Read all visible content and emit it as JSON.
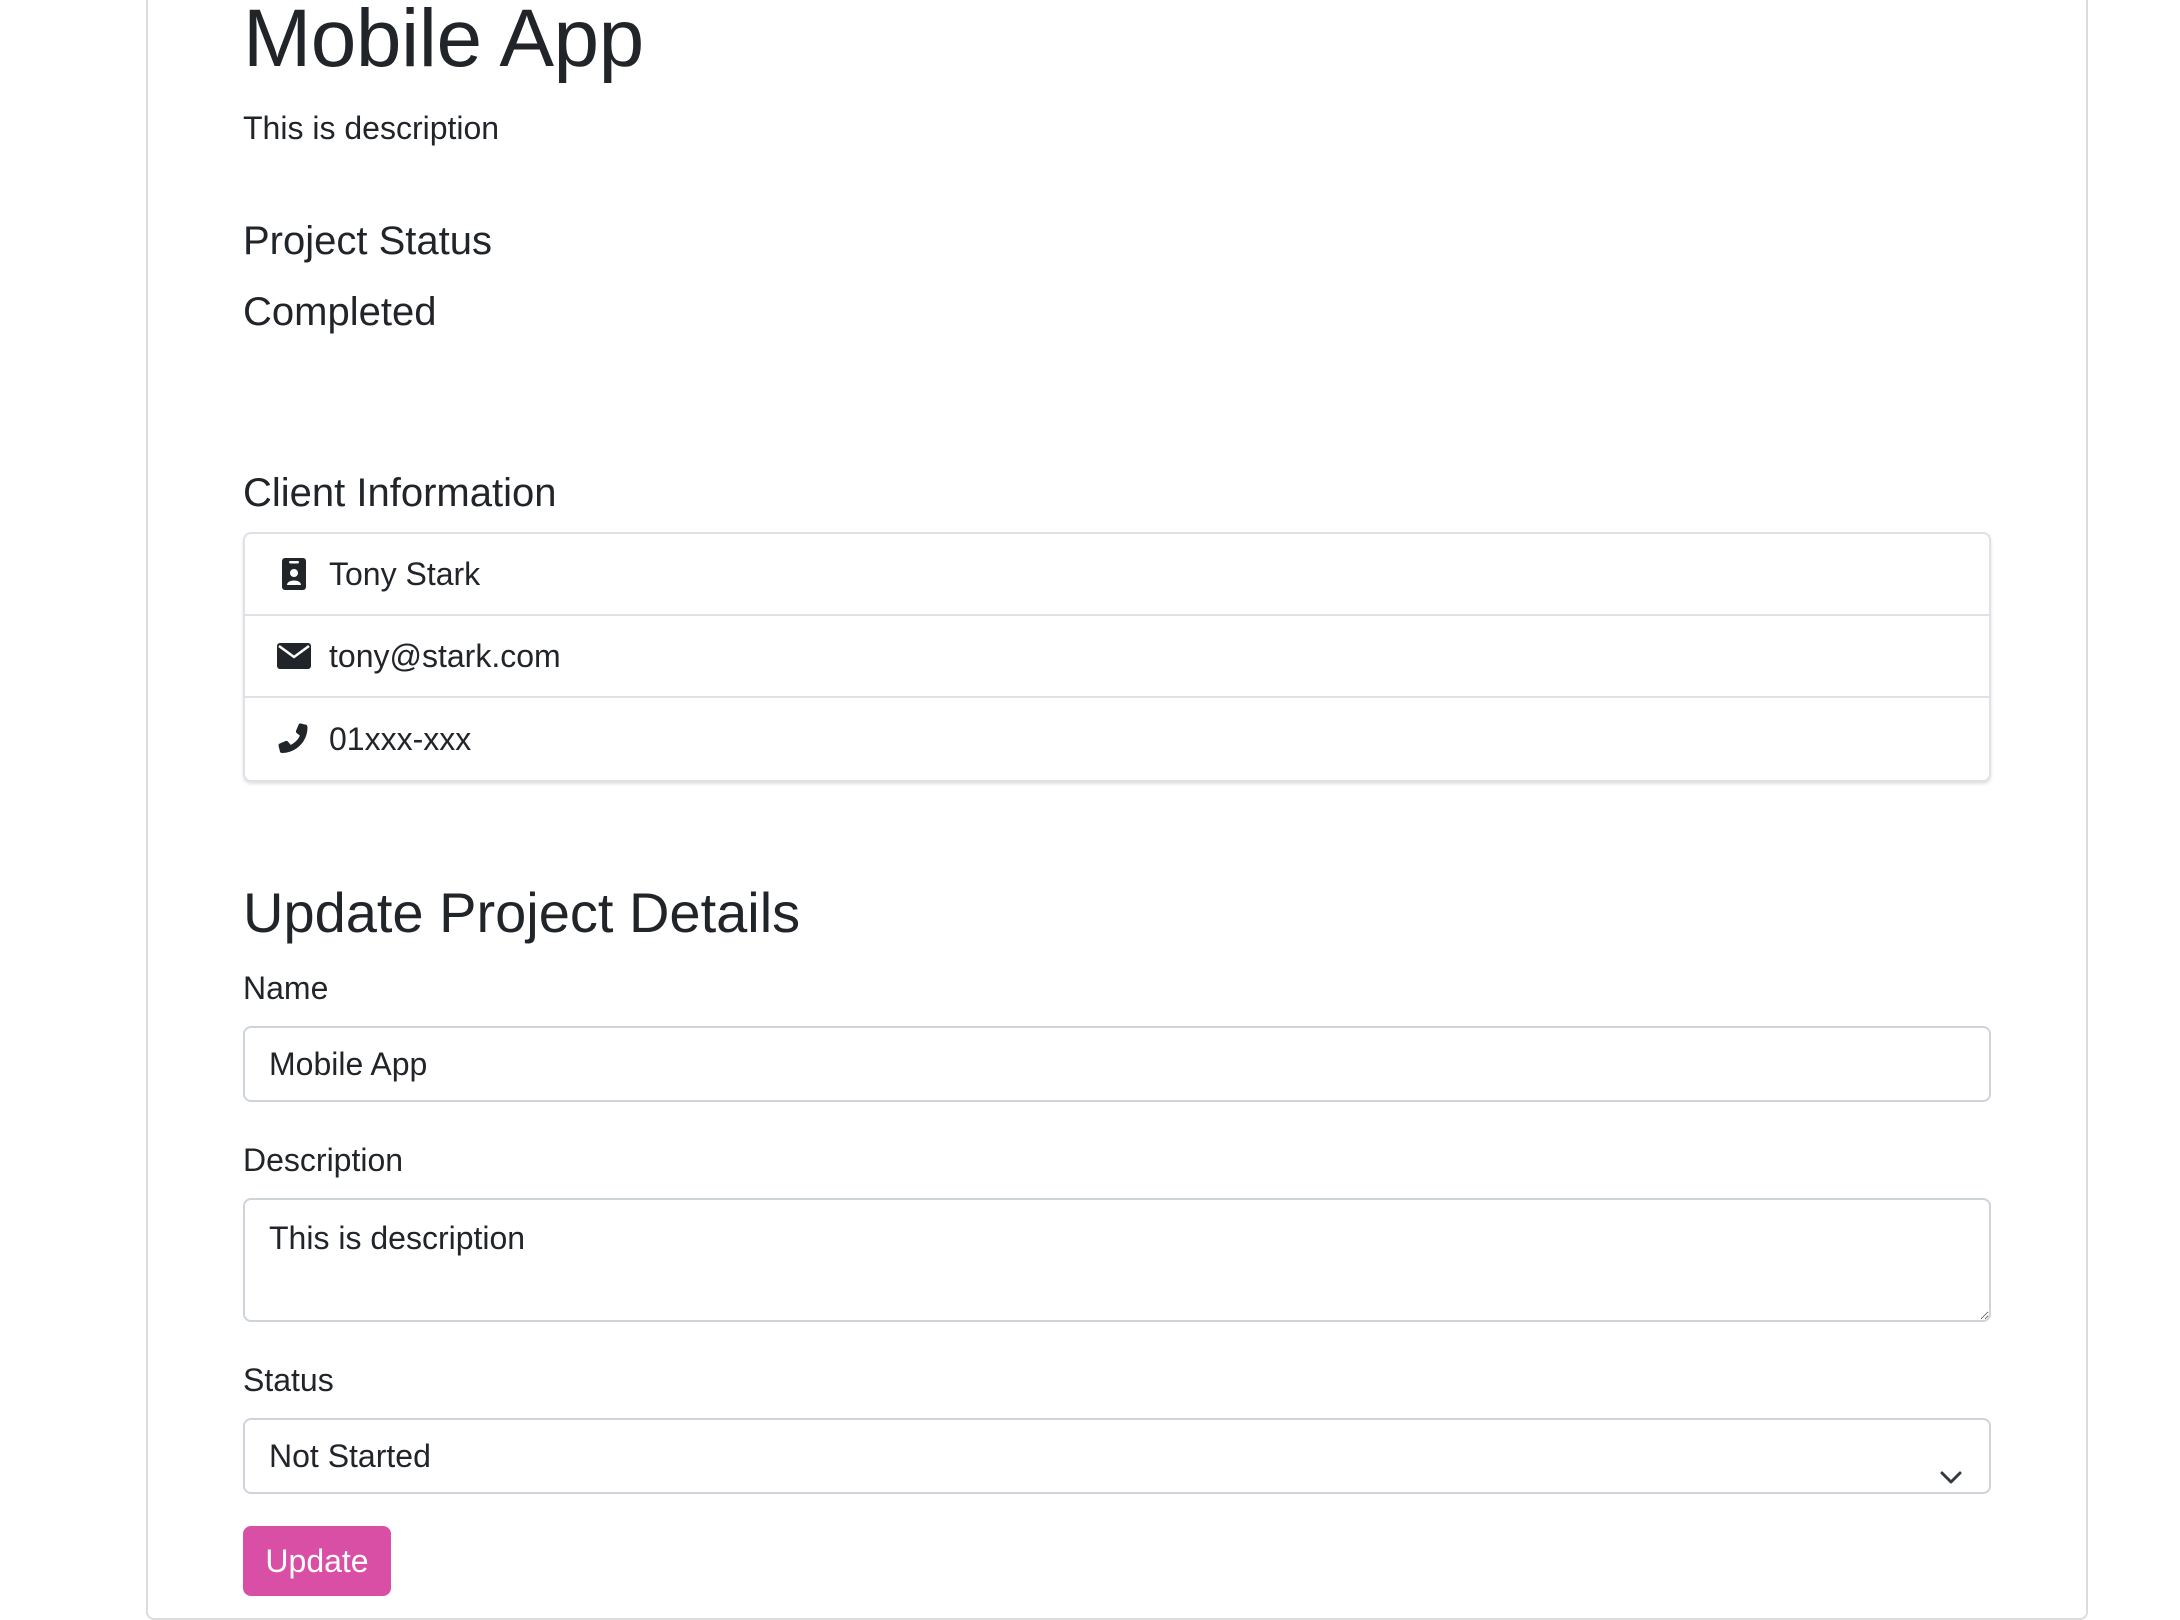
{
  "project": {
    "title": "Mobile App",
    "description": "This is description",
    "status_heading": "Project Status",
    "status_value": "Completed"
  },
  "client": {
    "heading": "Client Information",
    "items": [
      {
        "icon": "id-badge-icon",
        "text": "Tony Stark"
      },
      {
        "icon": "envelope-icon",
        "text": "tony@stark.com"
      },
      {
        "icon": "phone-icon",
        "text": "01xxx-xxx"
      }
    ]
  },
  "form": {
    "heading": "Update Project Details",
    "name_label": "Name",
    "name_value": "Mobile App",
    "description_label": "Description",
    "description_value": "This is description",
    "status_label": "Status",
    "status_selected": "Not Started",
    "submit_label": "Update"
  },
  "colors": {
    "button": "#d94fa6",
    "text": "#212529",
    "border": "#ced4da"
  }
}
